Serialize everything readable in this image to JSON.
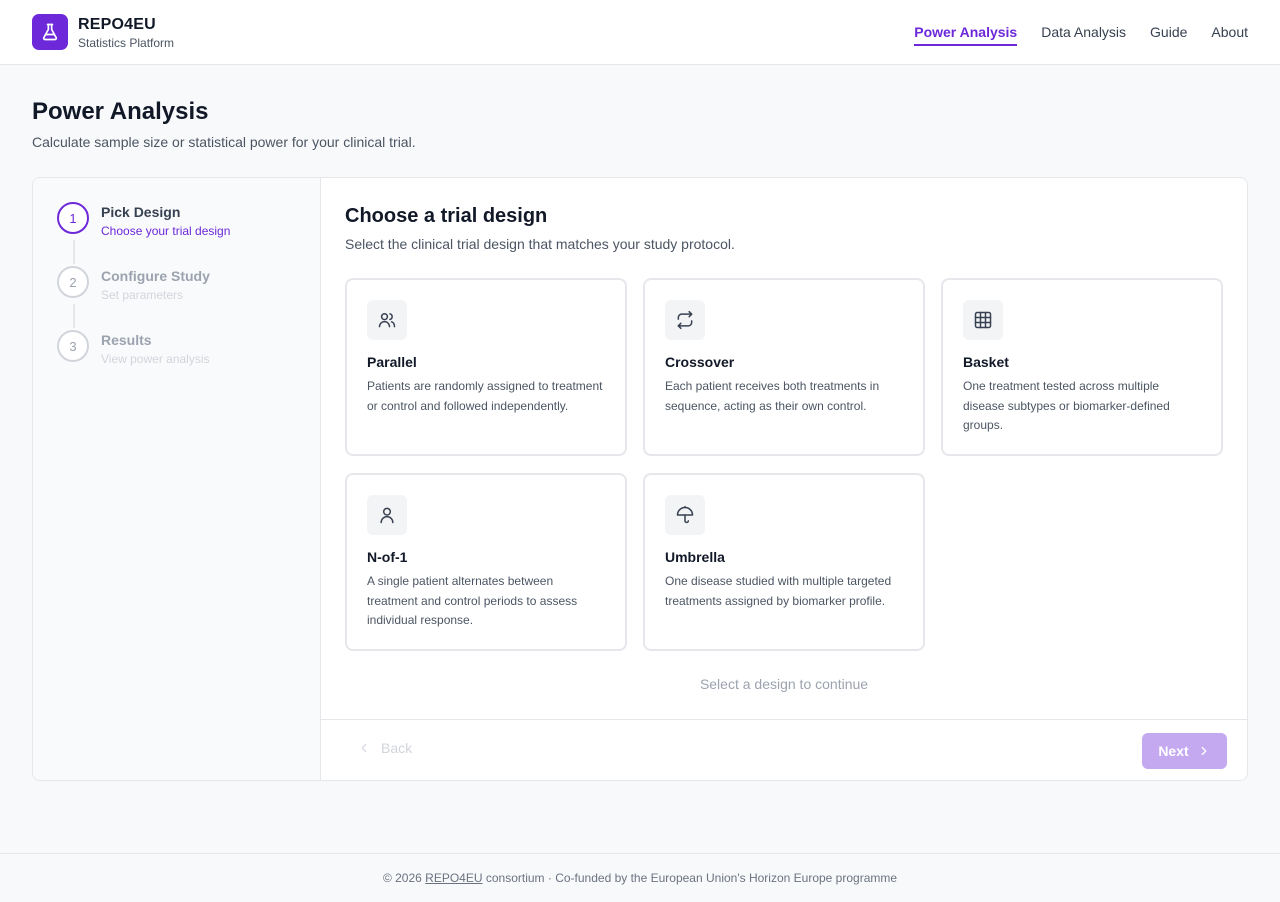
{
  "header": {
    "brand_title": "REPO4EU",
    "brand_subtitle": "Statistics Platform",
    "logo_icon": "flask-icon",
    "nav": [
      {
        "label": "Power Analysis",
        "active": true
      },
      {
        "label": "Data Analysis",
        "active": false
      },
      {
        "label": "Guide",
        "active": false
      },
      {
        "label": "About",
        "active": false
      }
    ]
  },
  "page": {
    "title": "Power Analysis",
    "subtitle": "Calculate sample size or statistical power for your clinical trial."
  },
  "steps": [
    {
      "number": "1",
      "title": "Pick Design",
      "desc": "Choose your trial design",
      "active": true
    },
    {
      "number": "2",
      "title": "Configure Study",
      "desc": "Set parameters",
      "active": false
    },
    {
      "number": "3",
      "title": "Results",
      "desc": "View power analysis",
      "active": false
    }
  ],
  "main": {
    "title": "Choose a trial design",
    "subtitle": "Select the clinical trial design that matches your study protocol.",
    "designs": [
      {
        "name": "Parallel",
        "icon": "users-icon",
        "desc": "Patients are randomly assigned to treatment or control and followed independently."
      },
      {
        "name": "Crossover",
        "icon": "repeat-icon",
        "desc": "Each patient receives both treatments in sequence, acting as their own control."
      },
      {
        "name": "Basket",
        "icon": "grid-icon",
        "desc": "One treatment tested across multiple disease subtypes or biomarker-defined groups."
      },
      {
        "name": "N-of-1",
        "icon": "user-icon",
        "desc": "A single patient alternates between treatment and control periods to assess individual response."
      },
      {
        "name": "Umbrella",
        "icon": "umbrella-icon",
        "desc": "One disease studied with multiple targeted treatments assigned by biomarker profile."
      }
    ],
    "hint": "Select a design to continue",
    "back_label": "Back",
    "next_label": "Next"
  },
  "footer": {
    "prefix": "© 2026 ",
    "link": "REPO4EU",
    "suffix": " consortium · Co-funded by the European Union's Horizon Europe programme"
  },
  "colors": {
    "accent": "#6d28d9",
    "accent_disabled": "#c4a8f0"
  }
}
